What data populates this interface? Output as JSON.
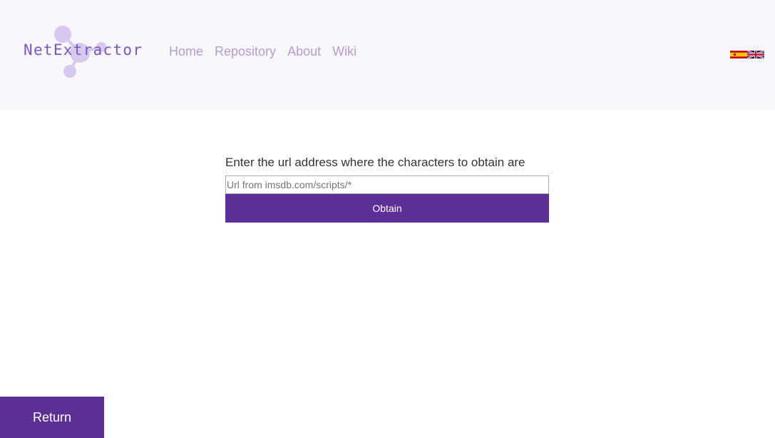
{
  "header": {
    "logo_text": "NetExtractor",
    "nav": [
      {
        "label": "Home"
      },
      {
        "label": "Repository"
      },
      {
        "label": "About"
      },
      {
        "label": "Wiki"
      }
    ],
    "flags": [
      {
        "icon": "spain-flag-icon"
      },
      {
        "icon": "uk-flag-icon"
      }
    ]
  },
  "form": {
    "label": "Enter the url address where the characters to obtain are",
    "input": {
      "value": "",
      "placeholder": "Url from imsdb.com/scripts/*"
    },
    "submit_label": "Obtain"
  },
  "footer": {
    "return_label": "Return"
  },
  "colors": {
    "accent": "#5b2f96",
    "nav_link": "#b99bcd",
    "logo_text": "#7a55c4",
    "header_bg": "#f8f7fb"
  }
}
